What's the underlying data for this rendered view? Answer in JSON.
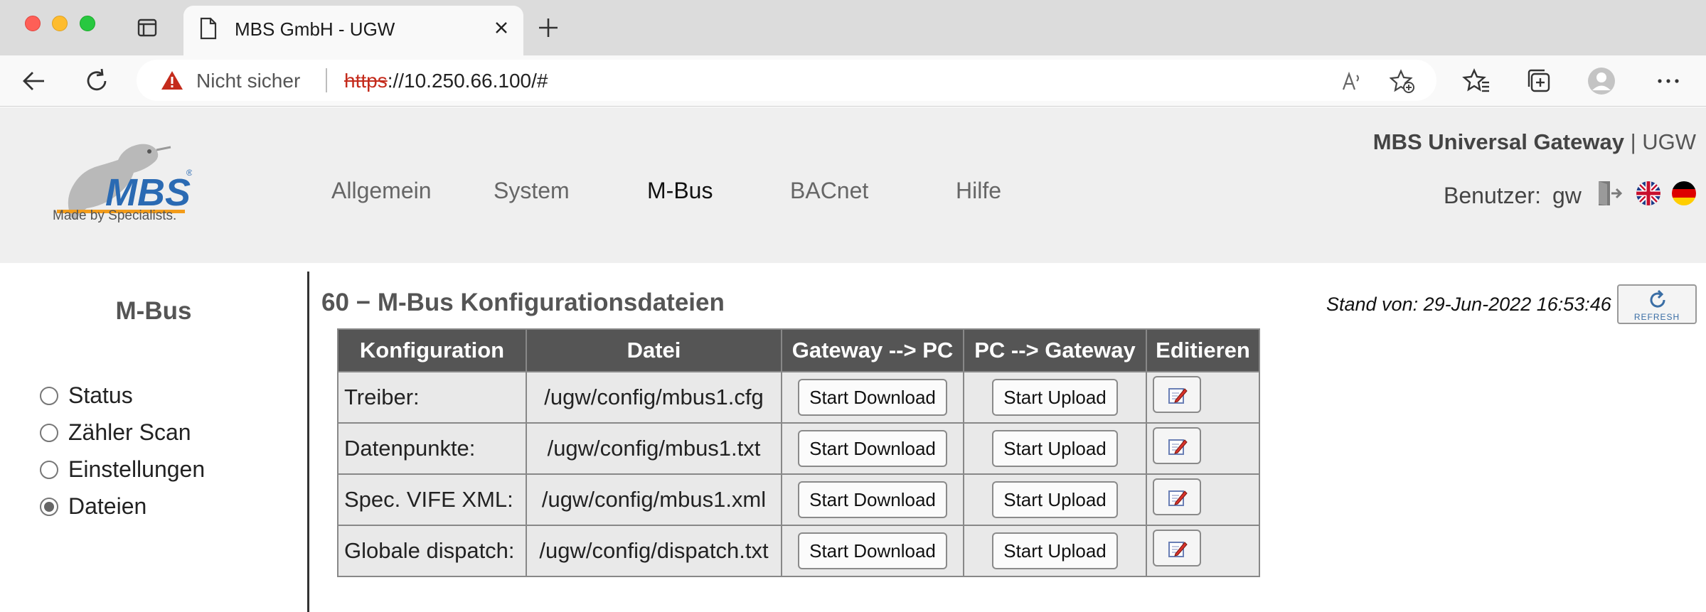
{
  "browser": {
    "tab_title": "MBS GmbH - UGW",
    "not_secure_label": "Nicht sicher",
    "url_scheme": "https",
    "url_rest": "://10.250.66.100/#"
  },
  "header": {
    "logo_text": "MBS",
    "logo_subtitle": "Made by Specialists.",
    "menu": [
      {
        "label": "Allgemein"
      },
      {
        "label": "System"
      },
      {
        "label": "M-Bus"
      },
      {
        "label": "BACnet"
      },
      {
        "label": "Hilfe"
      }
    ],
    "active_menu": "M-Bus",
    "gateway_title_bold": "MBS Universal Gateway",
    "gateway_title_rest": " | UGW",
    "user_label": "Benutzer:",
    "user_name": "gw"
  },
  "sidebar": {
    "title": "M-Bus",
    "items": [
      {
        "label": "Status",
        "checked": false
      },
      {
        "label": "Zähler Scan",
        "checked": false
      },
      {
        "label": "Einstellungen",
        "checked": false
      },
      {
        "label": "Dateien",
        "checked": true
      }
    ]
  },
  "main": {
    "title": "60 − M-Bus Konfigurationsdateien",
    "stand": "Stand von: 29-Jun-2022 16:53:46",
    "refresh_label": "REFRESH",
    "table": {
      "headers": [
        "Konfiguration",
        "Datei",
        "Gateway --> PC",
        "PC --> Gateway",
        "Editieren"
      ],
      "rows": [
        {
          "config": "Treiber:",
          "file": "/ugw/config/mbus1.cfg",
          "download": "Start Download",
          "upload": "Start Upload"
        },
        {
          "config": "Datenpunkte:",
          "file": "/ugw/config/mbus1.txt",
          "download": "Start Download",
          "upload": "Start Upload"
        },
        {
          "config": "Spec. VIFE XML:",
          "file": "/ugw/config/mbus1.xml",
          "download": "Start Download",
          "upload": "Start Upload"
        },
        {
          "config": "Globale dispatch:",
          "file": "/ugw/config/dispatch.txt",
          "download": "Start Download",
          "upload": "Start Upload"
        }
      ]
    }
  },
  "colors": {
    "header_bg": "#efefef",
    "table_header_bg": "#555555",
    "table_cell_bg": "#e9e9e9",
    "logo_blue": "#2a6ab3",
    "logo_orange": "#f39c1a"
  }
}
